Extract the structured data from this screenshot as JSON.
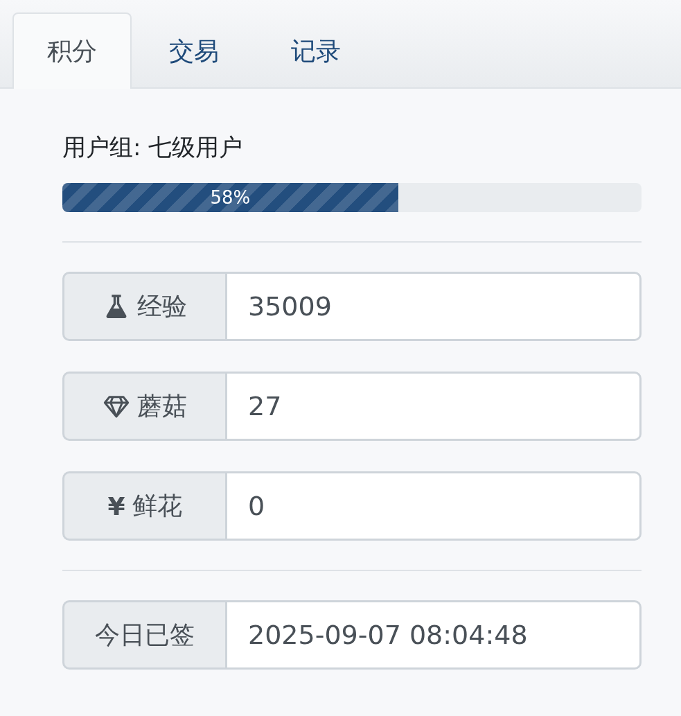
{
  "tabs": [
    {
      "label": "积分",
      "selected": true
    },
    {
      "label": "交易",
      "selected": false
    },
    {
      "label": "记录",
      "selected": false
    }
  ],
  "user_group": "用户组: 七级用户",
  "progress": {
    "level": 0.58,
    "label": "58%"
  },
  "sections": [
    [
      {
        "kind": "flask",
        "label": "经验",
        "value": "35009"
      },
      {
        "kind": "gem",
        "label": "蘑菇",
        "value": "27"
      },
      {
        "kind": "symbol",
        "symbol": "¥",
        "label": "鲜花",
        "value": "0"
      }
    ],
    [
      {
        "kind": "plain",
        "label": "今日已签",
        "value": "2025-09-07 08:04:48"
      }
    ]
  ]
}
